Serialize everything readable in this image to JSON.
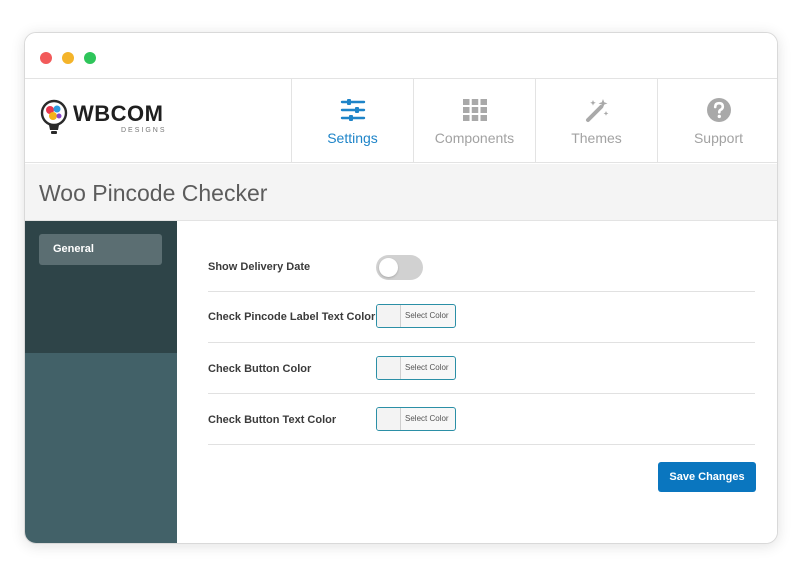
{
  "window": {
    "dots": [
      "#f25a5a",
      "#f4b42a",
      "#2ec55a"
    ]
  },
  "header": {
    "logo_text": "WBCOM",
    "logo_subtext": "DESIGNS",
    "tabs": [
      {
        "label": "Settings",
        "icon": "sliders-icon",
        "active": true
      },
      {
        "label": "Components",
        "icon": "grid-icon",
        "active": false
      },
      {
        "label": "Themes",
        "icon": "magic-wand-icon",
        "active": false
      },
      {
        "label": "Support",
        "icon": "question-circle-icon",
        "active": false
      }
    ]
  },
  "page": {
    "title": "Woo Pincode Checker"
  },
  "sidebar": {
    "items": [
      {
        "label": "General",
        "active": true
      }
    ]
  },
  "settings": {
    "rows": [
      {
        "label": "Show Delivery Date",
        "control": "toggle",
        "value": "off"
      },
      {
        "label": "Check Pincode Label Text Color",
        "control": "color",
        "button_label": "Select Color"
      },
      {
        "label": "Check Button Color",
        "control": "color",
        "button_label": "Select Color"
      },
      {
        "label": "Check Button Text Color",
        "control": "color",
        "button_label": "Select Color"
      }
    ],
    "save_label": "Save Changes"
  },
  "colors": {
    "accent": "#1e84c8",
    "save_button": "#0a76bf",
    "sidebar": "#426168",
    "sidebar_top": "#2e4448"
  }
}
